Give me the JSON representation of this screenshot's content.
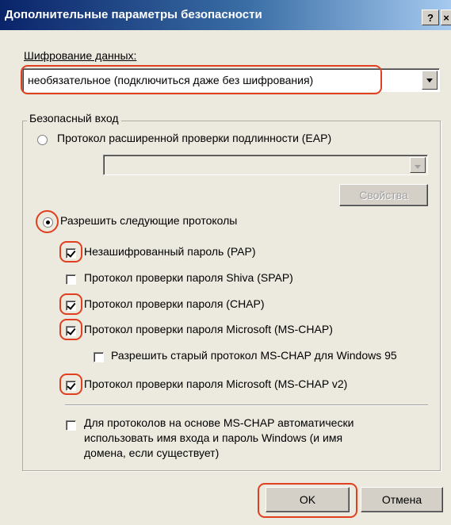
{
  "dialog": {
    "title": "Дополнительные параметры безопасности",
    "help_label": "?",
    "close_label": "×",
    "ok_label": "OK",
    "cancel_label": "Отмена"
  },
  "encryption": {
    "label": "Шифрование данных:",
    "selected": "необязательное (подключиться даже без шифрования)"
  },
  "logon": {
    "group_title": "Безопасный вход",
    "eap": {
      "label": "Протокол расширенной проверки подлинности (EAP)",
      "selected": false,
      "dropdown_value": "",
      "properties_label": "Свойства"
    },
    "allow": {
      "label": "Разрешить следующие протоколы",
      "selected": true
    },
    "protocols": [
      {
        "label": "Незашифрованный пароль (PAP)",
        "checked": true
      },
      {
        "label": "Протокол проверки пароля Shiva (SPAP)",
        "checked": false
      },
      {
        "label": "Протокол проверки пароля (CHAP)",
        "checked": true
      },
      {
        "label": "Протокол проверки пароля Microsoft (MS-CHAP)",
        "checked": true
      },
      {
        "label": "Разрешить старый протокол MS-CHAP для Windows 95",
        "checked": false
      },
      {
        "label": "Протокол проверки пароля Microsoft (MS-CHAP v2)",
        "checked": true
      }
    ],
    "auto_windows": {
      "line1": "Для протоколов на основе MS-CHAP автоматически",
      "line2": "использовать имя входа и пароль Windows (и имя",
      "line3": "домена, если существует)",
      "checked": false
    }
  },
  "colors": {
    "highlight": "#e04020",
    "title_bar": "#0a246a",
    "face": "#ece9df"
  }
}
